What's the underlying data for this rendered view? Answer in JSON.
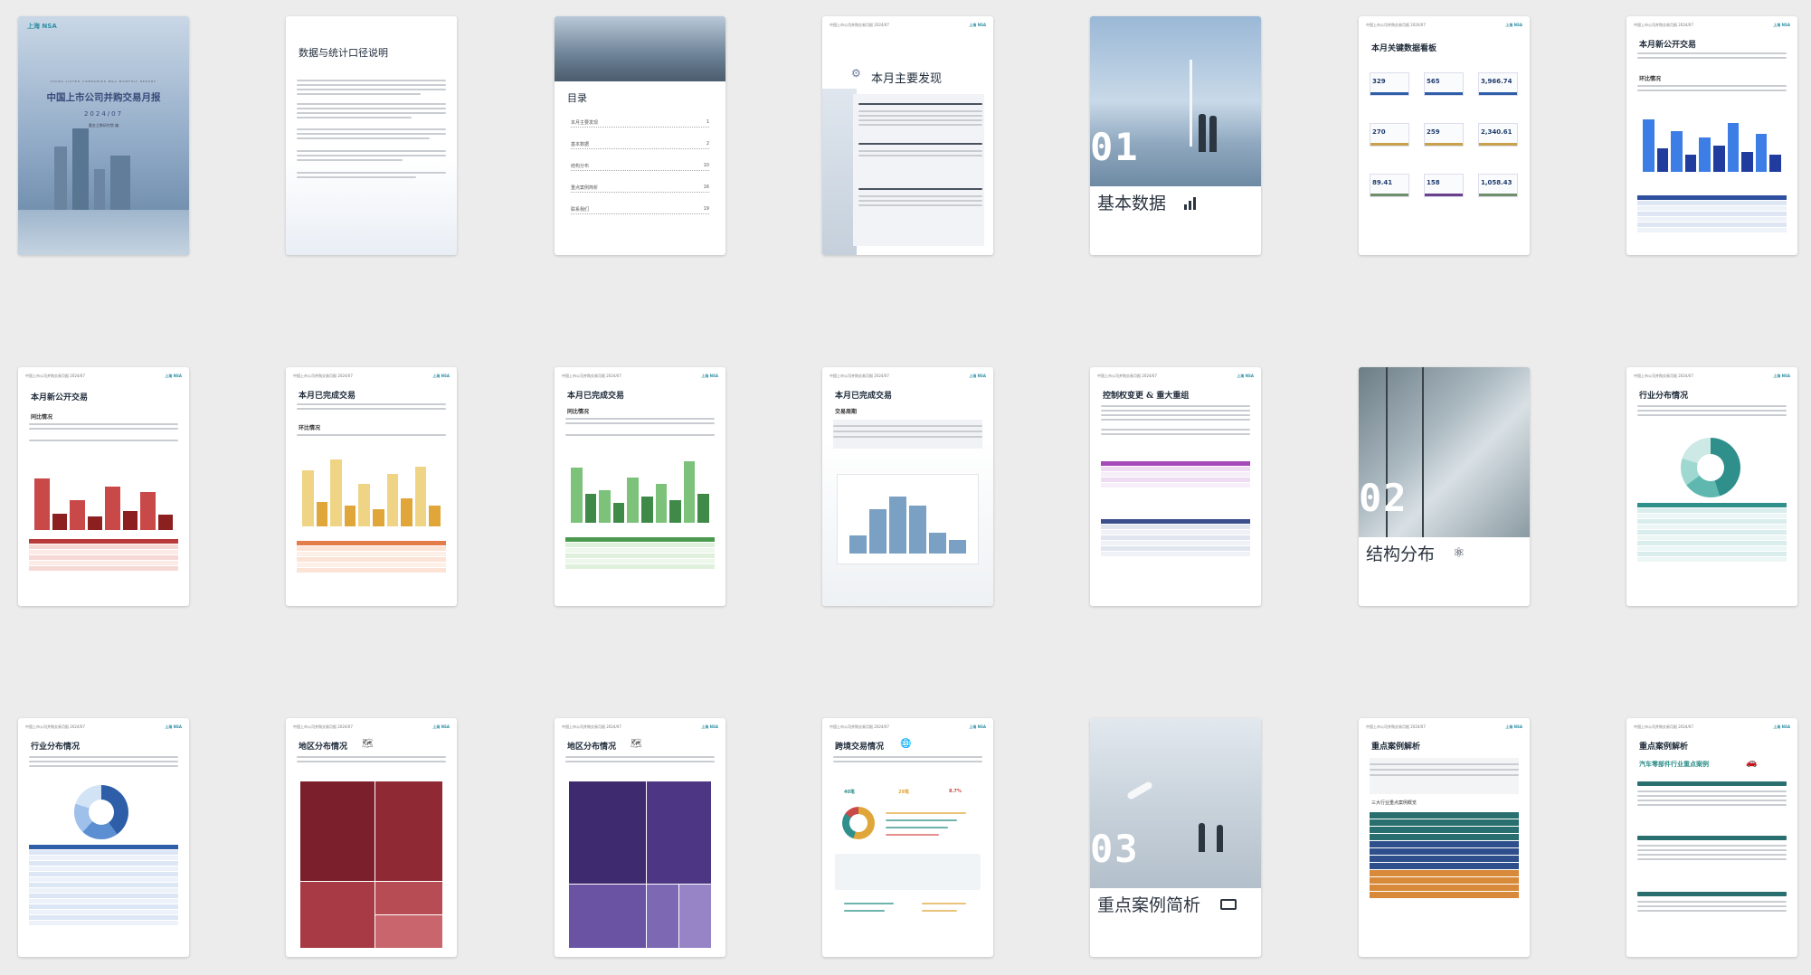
{
  "header": {
    "report": "中国上市公司并购交易月报 2024/07",
    "logo": "上海 NSA"
  },
  "cover": {
    "tagline": "CHINA LISTED COMPANIES M&A MONTHLY REPORT",
    "title": "中国上市公司并购交易月报",
    "date": "2024/07",
    "author": "重金之数研究院 编"
  },
  "p2": {
    "title": "数据与统计口径说明"
  },
  "toc": {
    "title": "目录",
    "items": [
      {
        "label": "本月主要发现",
        "page": "1"
      },
      {
        "label": "基本数据",
        "page": "2"
      },
      {
        "label": "结构分布",
        "page": "10"
      },
      {
        "label": "重点案例简析",
        "page": "16"
      },
      {
        "label": "联系我们",
        "page": "19"
      }
    ]
  },
  "p4": {
    "title": "本月主要发现"
  },
  "sec1": {
    "number": "01",
    "title": "基本数据"
  },
  "p6": {
    "title": "本月关键数据看板",
    "kpis": [
      "329",
      "565",
      "3,966.74",
      "270",
      "259",
      "2,340.61",
      "89.41",
      "158",
      "1,058.43"
    ]
  },
  "p7": {
    "title": "本月新公开交易",
    "sub": "环比情况"
  },
  "p8": {
    "title": "本月新公开交易",
    "sub": "同比情况"
  },
  "p9": {
    "title": "本月已完成交易",
    "sub": "环比情况"
  },
  "p10": {
    "title": "本月已完成交易",
    "sub": "同比情况"
  },
  "p11": {
    "title": "本月已完成交易",
    "sub": "交易周期"
  },
  "p12": {
    "title": "控制权变更 & 重大重组"
  },
  "sec2": {
    "number": "02",
    "title": "结构分布"
  },
  "p14": {
    "title": "行业分布情况"
  },
  "p15": {
    "title": "行业分布情况"
  },
  "p16": {
    "title": "地区分布情况"
  },
  "p17": {
    "title": "地区分布情况"
  },
  "p18": {
    "title": "跨境交易情况",
    "stats": [
      "40笔",
      "29笔",
      "8.7%"
    ]
  },
  "sec3": {
    "number": "03",
    "title": "重点案例简析"
  },
  "p20": {
    "title": "重点案例解析",
    "sub": "三大行业重点案例概览"
  },
  "p21": {
    "title": "重点案例解析",
    "sub": "汽车零部件行业重点案例"
  }
}
